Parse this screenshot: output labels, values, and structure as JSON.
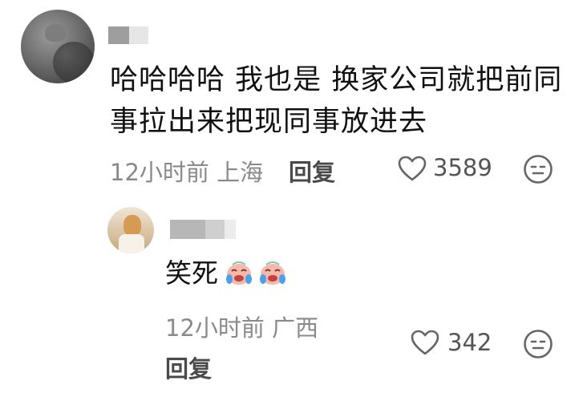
{
  "main_comment": {
    "text_line1": "哈哈哈哈 我也是 换家公司就把前同",
    "text_line2": "事拉出来把现同事放进去",
    "time": "12小时前",
    "location": "上海",
    "reply_label": "回复",
    "like_count": "3589",
    "icons": {
      "like": "heart-icon",
      "dislike": "neutral-face-icon",
      "avatar": "user-avatar"
    }
  },
  "reply_comment": {
    "text": "笑死",
    "emojis": [
      "crying-laughing-emoji",
      "crying-laughing-emoji"
    ],
    "time": "12小时前",
    "location": "广西",
    "reply_label": "回复",
    "like_count": "342",
    "icons": {
      "like": "heart-icon",
      "dislike": "neutral-face-icon",
      "avatar": "user-avatar"
    }
  },
  "colors": {
    "text": "#111111",
    "meta": "#8a8a8a",
    "icon": "#666666"
  }
}
